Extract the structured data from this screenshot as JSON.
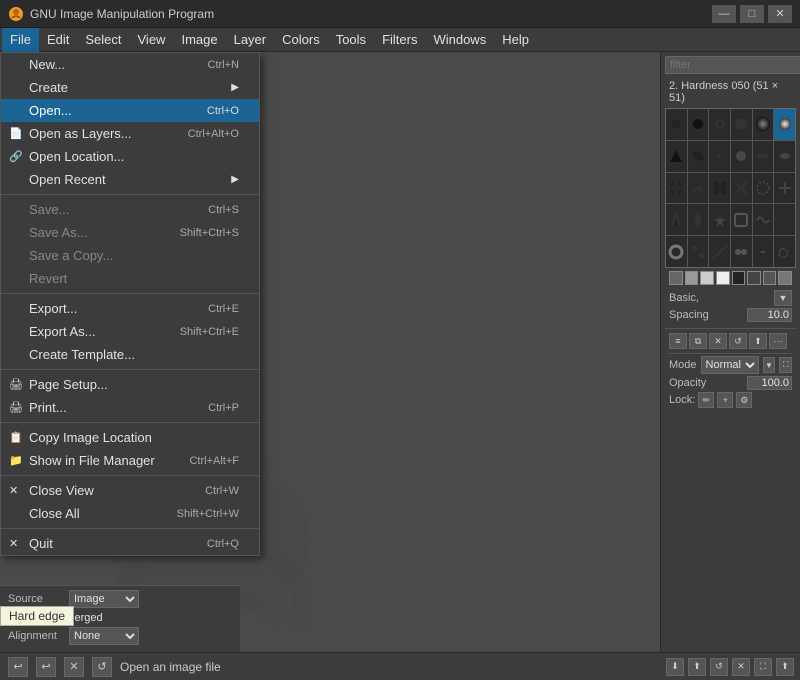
{
  "titlebar": {
    "icon": "🎨",
    "title": "GNU Image Manipulation Program",
    "minimize": "—",
    "maximize": "□",
    "close": "✕"
  },
  "menubar": {
    "items": [
      {
        "id": "file",
        "label": "File",
        "active": true
      },
      {
        "id": "edit",
        "label": "Edit"
      },
      {
        "id": "select",
        "label": "Select"
      },
      {
        "id": "view",
        "label": "View"
      },
      {
        "id": "image",
        "label": "Image"
      },
      {
        "id": "layer",
        "label": "Layer"
      },
      {
        "id": "colors",
        "label": "Colors"
      },
      {
        "id": "tools",
        "label": "Tools"
      },
      {
        "id": "filters",
        "label": "Filters"
      },
      {
        "id": "windows",
        "label": "Windows"
      },
      {
        "id": "help",
        "label": "Help"
      }
    ]
  },
  "file_menu": {
    "items": [
      {
        "id": "new",
        "label": "New...",
        "shortcut": "Ctrl+N",
        "icon": "",
        "type": "item"
      },
      {
        "id": "create",
        "label": "Create",
        "shortcut": "",
        "icon": "",
        "type": "item",
        "arrow": "▶"
      },
      {
        "id": "open",
        "label": "Open...",
        "shortcut": "Ctrl+O",
        "icon": "",
        "type": "item",
        "highlighted": true
      },
      {
        "id": "open-layers",
        "label": "Open as Layers...",
        "shortcut": "Ctrl+Alt+O",
        "icon": "📄",
        "type": "item"
      },
      {
        "id": "open-location",
        "label": "Open Location...",
        "shortcut": "",
        "icon": "🔗",
        "type": "item"
      },
      {
        "id": "open-recent",
        "label": "Open Recent",
        "shortcut": "",
        "icon": "",
        "type": "item",
        "arrow": "▶"
      },
      {
        "id": "sep1",
        "type": "separator"
      },
      {
        "id": "save",
        "label": "Save...",
        "shortcut": "Ctrl+S",
        "icon": "",
        "type": "item",
        "disabled": true
      },
      {
        "id": "save-as",
        "label": "Save As...",
        "shortcut": "Shift+Ctrl+S",
        "icon": "",
        "type": "item",
        "disabled": true
      },
      {
        "id": "save-copy",
        "label": "Save a Copy...",
        "shortcut": "",
        "icon": "",
        "type": "item",
        "disabled": true
      },
      {
        "id": "revert",
        "label": "Revert",
        "shortcut": "",
        "icon": "",
        "type": "item",
        "disabled": true
      },
      {
        "id": "sep2",
        "type": "separator"
      },
      {
        "id": "export",
        "label": "Export...",
        "shortcut": "Ctrl+E",
        "icon": "",
        "type": "item"
      },
      {
        "id": "export-as",
        "label": "Export As...",
        "shortcut": "Shift+Ctrl+E",
        "icon": "",
        "type": "item"
      },
      {
        "id": "create-template",
        "label": "Create Template...",
        "shortcut": "",
        "icon": "",
        "type": "item"
      },
      {
        "id": "sep3",
        "type": "separator"
      },
      {
        "id": "page-setup",
        "label": "Page Setup...",
        "shortcut": "",
        "icon": "🖨",
        "type": "item"
      },
      {
        "id": "print",
        "label": "Print...",
        "shortcut": "Ctrl+P",
        "icon": "🖨",
        "type": "item"
      },
      {
        "id": "sep4",
        "type": "separator"
      },
      {
        "id": "copy-location",
        "label": "Copy Image Location",
        "shortcut": "",
        "icon": "📋",
        "type": "item"
      },
      {
        "id": "file-manager",
        "label": "Show in File Manager",
        "shortcut": "Ctrl+Alt+F",
        "icon": "📁",
        "type": "item"
      },
      {
        "id": "sep5",
        "type": "separator"
      },
      {
        "id": "close-view",
        "label": "Close View",
        "shortcut": "Ctrl+W",
        "icon": "✕",
        "type": "item"
      },
      {
        "id": "close-all",
        "label": "Close All",
        "shortcut": "Shift+Ctrl+W",
        "icon": "",
        "type": "item"
      },
      {
        "id": "sep6",
        "type": "separator"
      },
      {
        "id": "quit",
        "label": "Quit",
        "shortcut": "Ctrl+Q",
        "icon": "✕",
        "type": "item"
      }
    ]
  },
  "brush_panel": {
    "filter_placeholder": "filter",
    "brush_name": "2. Hardness 050 (51 × 51)",
    "category": "Basic,",
    "spacing_label": "Spacing",
    "spacing_value": "10.0"
  },
  "layers_panel": {
    "mode_label": "Mode",
    "mode_value": "Normal",
    "opacity_label": "Opacity",
    "opacity_value": "100.0",
    "lock_label": "Lock:"
  },
  "bottom_bar": {
    "status": "Open an image file"
  },
  "tool_options": {
    "hard_edge_label": "Hard edge",
    "source_label": "Source",
    "source_value": "Image",
    "sample_merged_label": "Sample merged",
    "alignment_label": "Alignment",
    "alignment_value": "None"
  }
}
